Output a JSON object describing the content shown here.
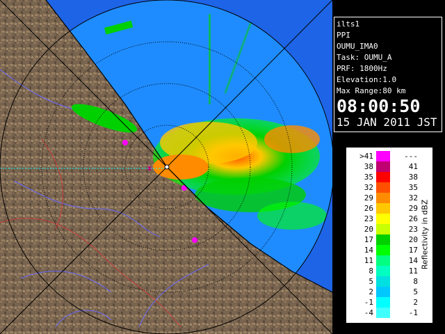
{
  "info": {
    "lines": [
      "ilts1",
      "PPI",
      "OUMU_IMA0",
      "Task: OUMU_A",
      "PRF: 1800Hz",
      "Elevation:1.0",
      "Max Range:80 km"
    ],
    "time": "08:00:50",
    "date": "15 JAN 2011 JST"
  },
  "legend": {
    "title": "Reflectivity in dBZ",
    "rows": [
      {
        "left": ">41",
        "right": "---",
        "color": "#ff00ff"
      },
      {
        "left": "38",
        "right": "41",
        "color": "#c00070"
      },
      {
        "left": "35",
        "right": "38",
        "color": "#ff0000"
      },
      {
        "left": "32",
        "right": "35",
        "color": "#ff5000"
      },
      {
        "left": "29",
        "right": "32",
        "color": "#ff8c00"
      },
      {
        "left": "26",
        "right": "29",
        "color": "#ffc800"
      },
      {
        "left": "23",
        "right": "26",
        "color": "#ffff00"
      },
      {
        "left": "20",
        "right": "23",
        "color": "#c8ff00"
      },
      {
        "left": "17",
        "right": "20",
        "color": "#00d000"
      },
      {
        "left": "14",
        "right": "17",
        "color": "#00ff00"
      },
      {
        "left": "11",
        "right": "14",
        "color": "#00ff80"
      },
      {
        "left": "8",
        "right": "11",
        "color": "#00ffc0"
      },
      {
        "left": "5",
        "right": "8",
        "color": "#00e0e0"
      },
      {
        "left": "2",
        "right": "5",
        "color": "#00c8ff"
      },
      {
        "left": "-1",
        "right": "2",
        "color": "#00ffff"
      },
      {
        "left": "-4",
        "right": "-1",
        "color": "#40ffff"
      }
    ]
  },
  "colors": {
    "sea_outer": "#1e64e6",
    "sea_inner": "#1e8cff",
    "land": "#786450",
    "range_rings": "#000000",
    "coast": "#000000"
  },
  "map_features": {
    "radar_site_icon": "radar-site",
    "range_ring_count": 4
  }
}
